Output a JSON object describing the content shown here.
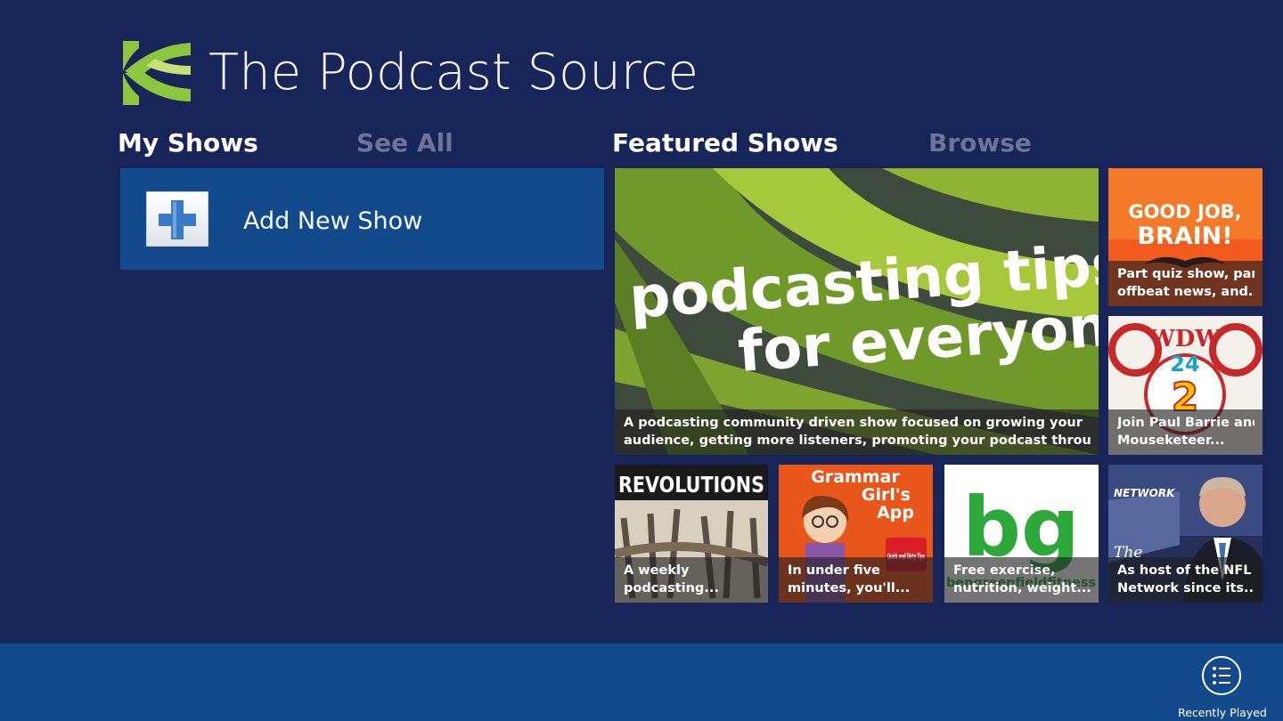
{
  "app": {
    "title": "The Podcast Source",
    "logo_icon": "podcast-source-logo",
    "accent_green": "#8cc63f",
    "background": "#172559",
    "tile_blue": "#124a8c"
  },
  "sections": {
    "my_shows": "My Shows",
    "see_all": "See All",
    "featured_shows": "Featured Shows",
    "browse": "Browse"
  },
  "my_shows": {
    "add_new_show": "Add New Show",
    "add_icon": "plus-icon"
  },
  "featured": [
    {
      "id": "podcasting-tips",
      "art_text_1": "podcasting tips",
      "art_text_2": "for everyone",
      "caption_1": "A podcasting community driven show focused on growing your",
      "caption_2": "audience, getting more listeners, promoting your podcast through..."
    },
    {
      "id": "good-job-brain",
      "art_text_1": "GOOD JOB,",
      "art_text_2": "BRAIN!",
      "caption_1": "Part quiz show, part",
      "caption_2": "offbeat news, and..."
    },
    {
      "id": "wdw-radio",
      "art_text_1": "WDW",
      "art_text_2": "24",
      "art_text_3": "2",
      "caption_1": "Join Paul Barrie and",
      "caption_2": "Mouseketeer..."
    },
    {
      "id": "revolutions",
      "art_text_1": "REVOLUTIONS",
      "caption_1": "A weekly",
      "caption_2": "podcasting..."
    },
    {
      "id": "grammar-girl",
      "art_text_1": "Grammar",
      "art_text_2": "Girl's",
      "art_text_3": "App",
      "art_text_4": "Quick and Dirty Tips",
      "caption_1": "In under five",
      "caption_2": "minutes, you'll..."
    },
    {
      "id": "ben-greenfield",
      "art_text_1": "bg",
      "art_text_2": "bengreenfieldfitness",
      "caption_1": "Free exercise,",
      "caption_2": "nutrition, weight..."
    },
    {
      "id": "nfl-network",
      "art_text_1": "NETWORK",
      "art_text_2": "The",
      "caption_1": "As host of the NFL",
      "caption_2": "Network since its..."
    }
  ],
  "appbar": {
    "recently_played": "Recently Played",
    "recently_played_icon": "list-icon"
  }
}
